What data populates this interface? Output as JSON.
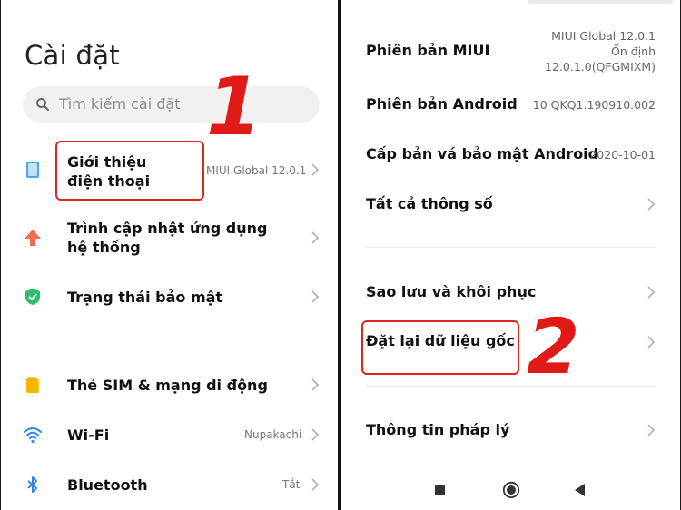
{
  "left": {
    "title": "Cài đặt",
    "search_placeholder": "Tìm kiếm cài đặt",
    "items": [
      {
        "label": "Giới thiệu điện thoại",
        "value": "MIUI Global 12.0.1",
        "icon": "phone-icon",
        "color": "#4aa8e6"
      },
      {
        "label": "Trình cập nhật ứng dụng hệ thống",
        "value": "",
        "icon": "arrow-up-icon",
        "color": "#f26b4f"
      },
      {
        "label": "Trạng thái bảo mật",
        "value": "",
        "icon": "shield-icon",
        "color": "#2fbf6a"
      },
      {
        "label": "Thẻ SIM & mạng di động",
        "value": "",
        "icon": "sim-card-icon",
        "color": "#f5c518"
      },
      {
        "label": "Wi-Fi",
        "value": "Nupakachi",
        "icon": "wifi-icon",
        "color": "#3a8ee6"
      },
      {
        "label": "Bluetooth",
        "value": "Tắt",
        "icon": "bluetooth-icon",
        "color": "#2f86e6"
      }
    ],
    "annotation": "1"
  },
  "right": {
    "rows": [
      {
        "label": "Phiên bản MIUI",
        "value_lines": [
          "MIUI Global 12.0.1",
          "Ổn định",
          "12.0.1.0(QFGMIXM)"
        ]
      },
      {
        "label": "Phiên bản Android",
        "value_lines": [
          "10 QKQ1.190910.002"
        ]
      },
      {
        "label": "Cấp bản vá bảo mật Android",
        "value_lines": [
          "2020-10-01"
        ]
      },
      {
        "label": "Tất cả thông số",
        "value_lines": []
      },
      {
        "label": "Sao lưu và khôi phục",
        "value_lines": []
      },
      {
        "label": "Đặt lại dữ liệu gốc",
        "value_lines": []
      },
      {
        "label": "Thông tin pháp lý",
        "value_lines": []
      }
    ],
    "annotation": "2"
  },
  "colors": {
    "accent_red": "#e01a16",
    "label": "#111111",
    "secondary": "#777777"
  }
}
